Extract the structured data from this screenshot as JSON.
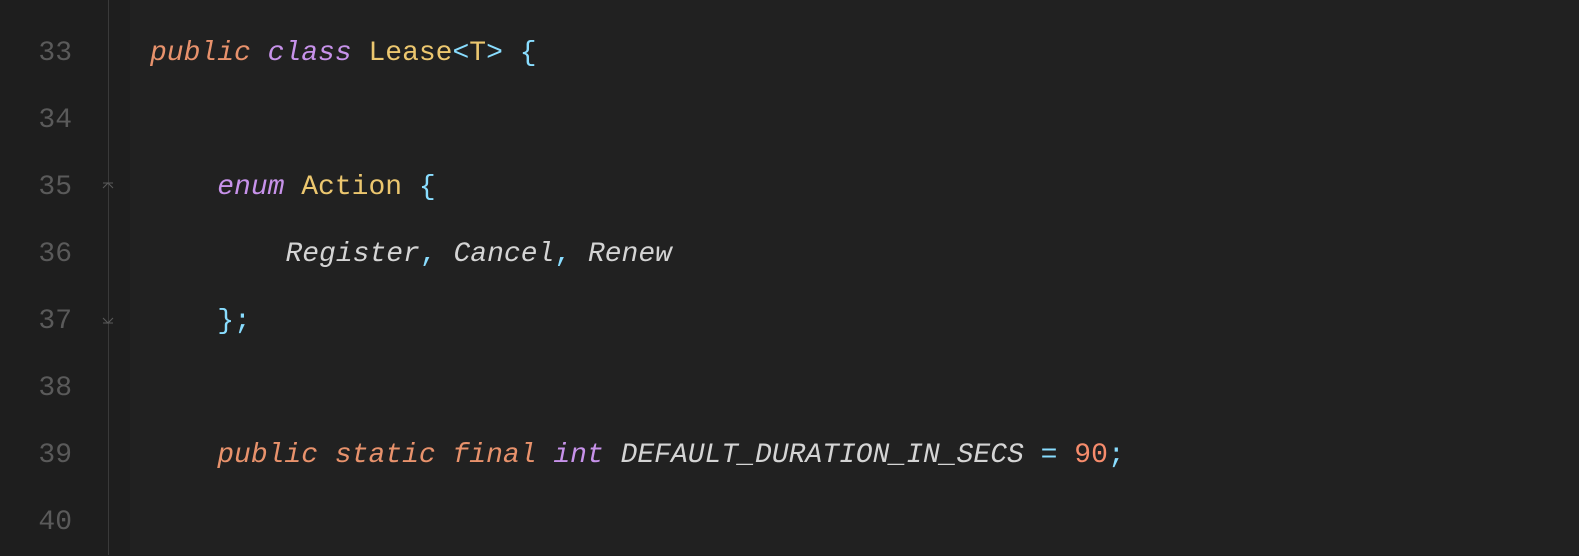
{
  "lines": {
    "33": "33",
    "34": "34",
    "35": "35",
    "36": "36",
    "37": "37",
    "38": "38",
    "39": "39",
    "40": "40"
  },
  "code": {
    "l33": {
      "public": "public",
      "class": "class",
      "Lease": "Lease",
      "lt": "<",
      "T": "T",
      "gt": ">",
      "brace": "{"
    },
    "l35": {
      "enum": "enum",
      "Action": "Action",
      "brace": "{"
    },
    "l36": {
      "Register": "Register",
      "c1": ",",
      "Cancel": "Cancel",
      "c2": ",",
      "Renew": "Renew"
    },
    "l37": {
      "brace": "}",
      "semi": ";"
    },
    "l39": {
      "public": "public",
      "static": "static",
      "final": "final",
      "int": "int",
      "name": "DEFAULT_DURATION_IN_SECS",
      "eq": "=",
      "val": "90",
      "semi": ";"
    }
  }
}
